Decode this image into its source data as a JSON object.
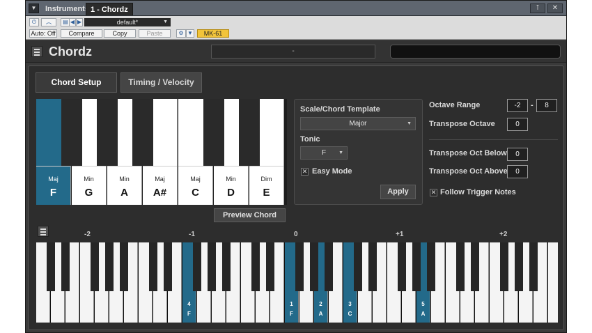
{
  "window": {
    "tabs": [
      {
        "label": "Instruments"
      },
      {
        "label": "1 - Chordz"
      }
    ],
    "buttons": {
      "pin": "⊺",
      "close": "✕"
    }
  },
  "toolbar": {
    "preset": "default*",
    "auto_off": "Auto: Off",
    "compare": "Compare",
    "copy": "Copy",
    "paste": "Paste",
    "device": "MK-61"
  },
  "header": {
    "title": "Chordz",
    "preset_display": "-"
  },
  "tabs": {
    "setup": "Chord Setup",
    "timing": "Timing / Velocity"
  },
  "chord_keys": [
    {
      "quality": "Maj",
      "note": "F",
      "active": true
    },
    {
      "quality": "Min",
      "note": "G",
      "active": false
    },
    {
      "quality": "Min",
      "note": "A",
      "active": false
    },
    {
      "quality": "Maj",
      "note": "A#",
      "active": false
    },
    {
      "quality": "Maj",
      "note": "C",
      "active": false
    },
    {
      "quality": "Min",
      "note": "D",
      "active": false
    },
    {
      "quality": "Dim",
      "note": "E",
      "active": false
    }
  ],
  "scale": {
    "template_label": "Scale/Chord Template",
    "template_value": "Major",
    "tonic_label": "Tonic",
    "tonic_value": "F",
    "easy_mode_label": "Easy Mode",
    "easy_mode_checked": "✕",
    "apply": "Apply"
  },
  "preview_button": "Preview Chord",
  "settings": {
    "octave_range_label": "Octave Range",
    "octave_range_low": "-2",
    "octave_range_sep": "-",
    "octave_range_high": "8",
    "transpose_octave_label": "Transpose Octave",
    "transpose_octave": "0",
    "transpose_below_label": "Transpose Oct Below",
    "transpose_below": "0",
    "transpose_above_label": "Transpose Oct Above",
    "transpose_above": "0",
    "follow_label": "Follow Trigger Notes",
    "follow_checked": "✕"
  },
  "piano": {
    "octave_labels": [
      "-2",
      "-1",
      "0",
      "+1",
      "+2"
    ],
    "highlighted": [
      {
        "white_index": 10,
        "num": "4",
        "note": "F"
      },
      {
        "white_index": 17,
        "num": "1",
        "note": "F"
      },
      {
        "white_index": 19,
        "num": "2",
        "note": "A"
      },
      {
        "white_index": 21,
        "num": "3",
        "note": "C"
      },
      {
        "white_index": 26,
        "num": "5",
        "note": "A"
      }
    ]
  }
}
